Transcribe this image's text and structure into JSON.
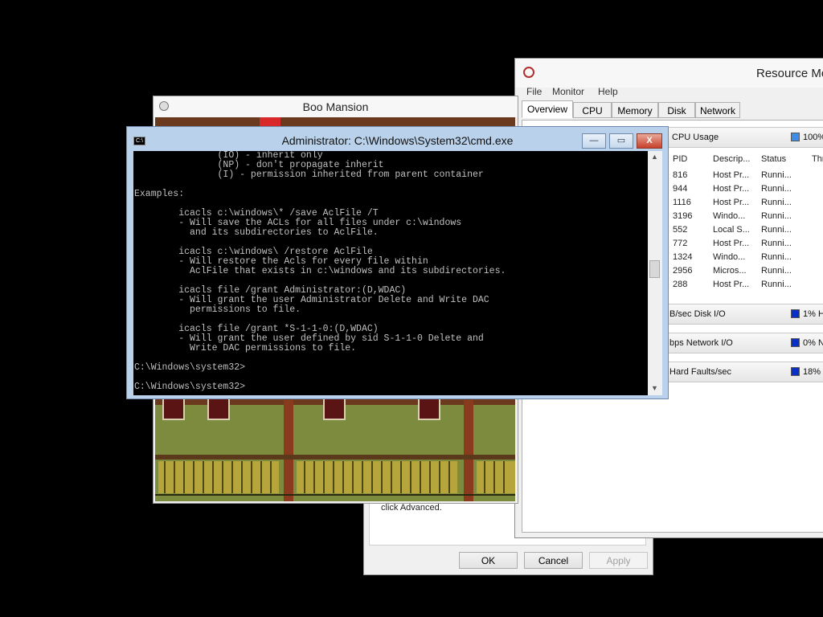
{
  "properties_dialog": {
    "text": "click Advanced.",
    "ok_label": "OK",
    "cancel_label": "Cancel",
    "apply_label": "Apply"
  },
  "resource_monitor": {
    "title": "Resource Mo",
    "menu": [
      "File",
      "Monitor",
      "Help"
    ],
    "tabs": [
      "Overview",
      "CPU",
      "Memory",
      "Disk",
      "Network"
    ],
    "cpu_section": {
      "label": "CPU Usage",
      "value": "100%",
      "color": "#3c8ee8"
    },
    "columns": [
      "PID",
      "Descrip...",
      "Status",
      "Thr"
    ],
    "rows": [
      {
        "pid": "816",
        "desc": "Host Pr...",
        "status": "Runni..."
      },
      {
        "pid": "944",
        "desc": "Host Pr...",
        "status": "Runni..."
      },
      {
        "pid": "1116",
        "desc": "Host Pr...",
        "status": "Runni..."
      },
      {
        "pid": "3196",
        "desc": "Windo...",
        "status": "Runni..."
      },
      {
        "pid": "552",
        "desc": "Local S...",
        "status": "Runni..."
      },
      {
        "pid": "772",
        "desc": "Host Pr...",
        "status": "Runni..."
      },
      {
        "pid": "1324",
        "desc": "Windo...",
        "status": "Runni..."
      },
      {
        "pid": "2956",
        "desc": "Micros...",
        "status": "Runni..."
      },
      {
        "pid": "288",
        "desc": "Host Pr...",
        "status": "Runni..."
      }
    ],
    "disk_section": {
      "label": "B/sec Disk I/O",
      "value": "1% H",
      "color": "#0a2fc8"
    },
    "network_section": {
      "label": "bps Network I/O",
      "value": "0% N",
      "color": "#0a2fc8"
    },
    "memory_section": {
      "label": "Hard Faults/sec",
      "value": "18%",
      "color": "#0a2fc8"
    }
  },
  "game_window": {
    "title": "Boo Mansion"
  },
  "cmd_window": {
    "title": "Administrator: C:\\Windows\\System32\\cmd.exe",
    "icon_label": "C:\\",
    "minimize": "—",
    "maximize": "▭",
    "close": "X",
    "lines": [
      "               (IO) - inherit only",
      "               (NP) - don't propagate inherit",
      "               (I) - permission inherited from parent container",
      "",
      "Examples:",
      "",
      "        icacls c:\\windows\\* /save AclFile /T",
      "        - Will save the ACLs for all files under c:\\windows",
      "          and its subdirectories to AclFile.",
      "",
      "        icacls c:\\windows\\ /restore AclFile",
      "        - Will restore the Acls for every file within",
      "          AclFile that exists in c:\\windows and its subdirectories.",
      "",
      "        icacls file /grant Administrator:(D,WDAC)",
      "        - Will grant the user Administrator Delete and Write DAC",
      "          permissions to file.",
      "",
      "        icacls file /grant *S-1-1-0:(D,WDAC)",
      "        - Will grant the user defined by sid S-1-1-0 Delete and",
      "          Write DAC permissions to file.",
      "",
      "C:\\Windows\\system32>",
      "",
      "C:\\Windows\\system32>"
    ]
  }
}
